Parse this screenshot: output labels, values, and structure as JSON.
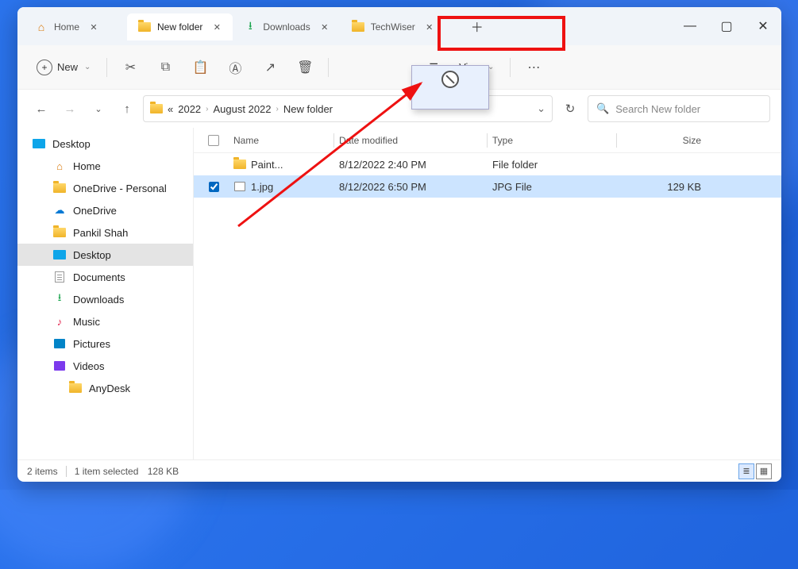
{
  "tabs": [
    {
      "label": "Home",
      "icon": "home"
    },
    {
      "label": "New folder",
      "icon": "folder",
      "active": true
    },
    {
      "label": "Downloads",
      "icon": "download"
    },
    {
      "label": "TechWiser",
      "icon": "folder",
      "highlighted": true
    }
  ],
  "toolbar": {
    "new_label": "New",
    "view_label": "View"
  },
  "breadcrumbs": {
    "prefix": "«",
    "items": [
      "2022",
      "August 2022",
      "New folder"
    ]
  },
  "search": {
    "placeholder": "Search New folder"
  },
  "sidebar": [
    {
      "label": "Desktop",
      "icon": "desktop",
      "indent": 0
    },
    {
      "label": "Home",
      "icon": "home",
      "indent": 1
    },
    {
      "label": "OneDrive - Personal",
      "icon": "folder",
      "indent": 1
    },
    {
      "label": "OneDrive",
      "icon": "onedrive",
      "indent": 1
    },
    {
      "label": "Pankil Shah",
      "icon": "folder",
      "indent": 1
    },
    {
      "label": "Desktop",
      "icon": "desktop",
      "indent": 1,
      "selected": true
    },
    {
      "label": "Documents",
      "icon": "doc",
      "indent": 1
    },
    {
      "label": "Downloads",
      "icon": "download",
      "indent": 1
    },
    {
      "label": "Music",
      "icon": "music",
      "indent": 1
    },
    {
      "label": "Pictures",
      "icon": "pic",
      "indent": 1
    },
    {
      "label": "Videos",
      "icon": "vid",
      "indent": 1
    },
    {
      "label": "AnyDesk",
      "icon": "folder",
      "indent": 2
    }
  ],
  "columns": {
    "name": "Name",
    "date": "Date modified",
    "type": "Type",
    "size": "Size"
  },
  "files": [
    {
      "name": "Paint...",
      "date": "8/12/2022 2:40 PM",
      "type": "File folder",
      "size": "",
      "icon": "folder",
      "checked": false
    },
    {
      "name": "1.jpg",
      "date": "8/12/2022 6:50 PM",
      "type": "JPG File",
      "size": "129 KB",
      "icon": "image",
      "checked": true,
      "selected": true
    }
  ],
  "status": {
    "count": "2 items",
    "selection": "1 item selected",
    "size": "128 KB"
  }
}
